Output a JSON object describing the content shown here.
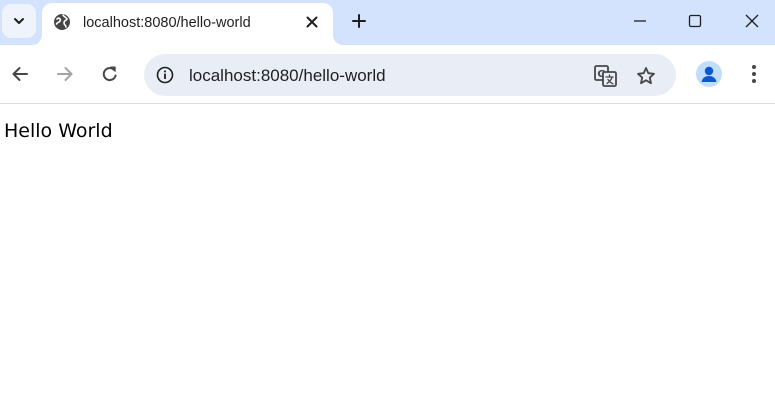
{
  "tab": {
    "title": "localhost:8080/hello-world",
    "favicon": "globe-icon"
  },
  "omnibox": {
    "url": "localhost:8080/hello-world"
  },
  "icons": {
    "tab_search": "chevron-down-icon",
    "close_tab": "close-icon",
    "new_tab": "plus-icon",
    "minimize": "minimize-icon",
    "maximize": "maximize-icon",
    "close_window": "close-icon",
    "back": "back-arrow-icon",
    "forward": "forward-arrow-icon",
    "reload": "reload-icon",
    "site_info": "info-icon",
    "translate": "translate-icon",
    "bookmark": "star-icon",
    "profile": "person-icon",
    "menu": "more-vert-icon"
  },
  "colors": {
    "tabstrip_bg": "#d3e3fd",
    "omnibox_bg": "#e9eef6",
    "avatar_bg": "#c2dcfb",
    "avatar_fg": "#0b57d0"
  },
  "page": {
    "text": "Hello World"
  }
}
